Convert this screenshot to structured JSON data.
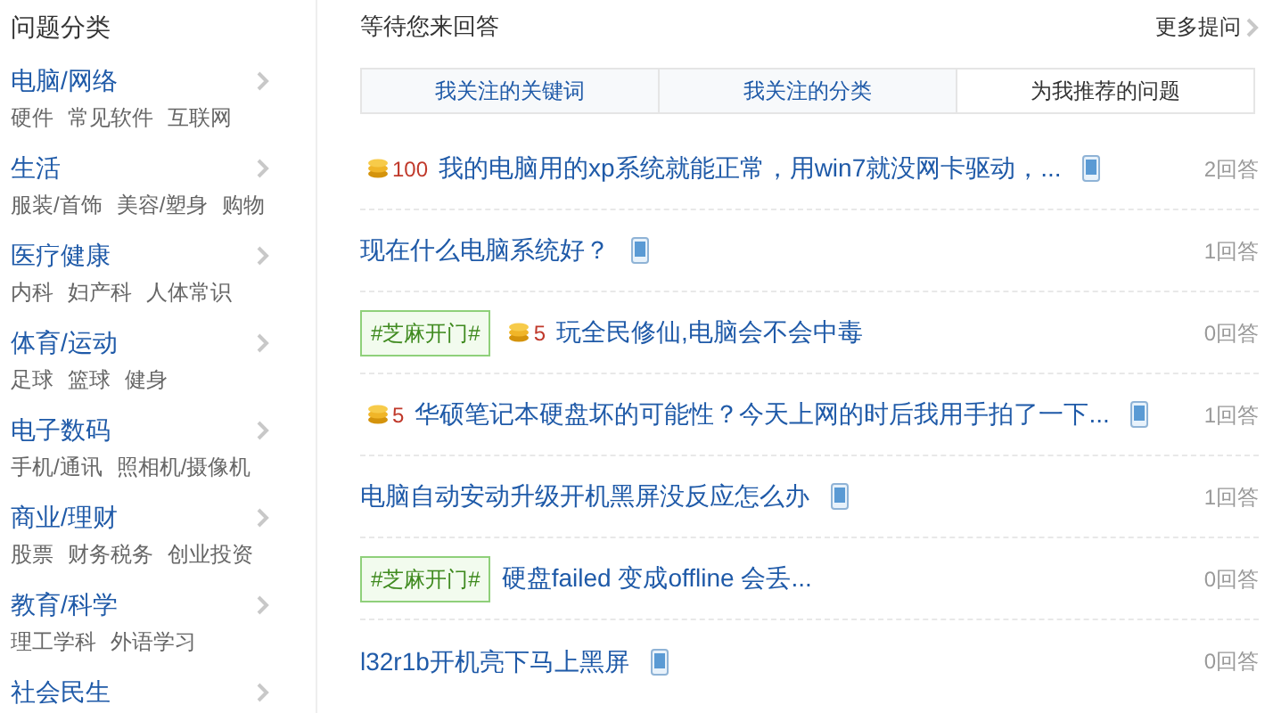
{
  "sidebar": {
    "title": "问题分类",
    "categories": [
      {
        "name": "电脑/网络",
        "subs": [
          "硬件",
          "常见软件",
          "互联网"
        ]
      },
      {
        "name": "生活",
        "subs": [
          "服装/首饰",
          "美容/塑身",
          "购物"
        ]
      },
      {
        "name": "医疗健康",
        "subs": [
          "内科",
          "妇产科",
          "人体常识"
        ]
      },
      {
        "name": "体育/运动",
        "subs": [
          "足球",
          "篮球",
          "健身"
        ]
      },
      {
        "name": "电子数码",
        "subs": [
          "手机/通讯",
          "照相机/摄像机"
        ]
      },
      {
        "name": "商业/理财",
        "subs": [
          "股票",
          "财务税务",
          "创业投资"
        ]
      },
      {
        "name": "教育/科学",
        "subs": [
          "理工学科",
          "外语学习"
        ]
      },
      {
        "name": "社会民生"
      }
    ]
  },
  "main": {
    "title": "等待您来回答",
    "more_link": "更多提问",
    "tabs": [
      {
        "label": "我关注的关键词",
        "selected": false
      },
      {
        "label": "我关注的分类",
        "selected": false
      },
      {
        "label": "为我推荐的问题",
        "selected": true
      }
    ],
    "questions": [
      {
        "reward": "100",
        "title": "我的电脑用的xp系统就能正常，用win7就没网卡驱动，...",
        "mobile": true,
        "answers": "2回答"
      },
      {
        "title": "现在什么电脑系统好？",
        "mobile": true,
        "answers": "1回答"
      },
      {
        "tag": "#芝麻开门#",
        "reward": "5",
        "title": "玩全民修仙,电脑会不会中毒",
        "mobile": false,
        "answers": "0回答"
      },
      {
        "reward": "5",
        "title": "华硕笔记本硬盘坏的可能性？今天上网的时后我用手拍了一下...",
        "mobile": true,
        "answers": "1回答"
      },
      {
        "title": "电脑自动安动升级开机黑屏没反应怎么办",
        "mobile": true,
        "answers": "1回答"
      },
      {
        "tag": "#芝麻开门#",
        "title": "硬盘failed 变成offline 会丢...",
        "mobile": false,
        "answers": "0回答"
      },
      {
        "title": "l32r1b开机亮下马上黑屏",
        "mobile": true,
        "answers": "0回答"
      }
    ]
  }
}
